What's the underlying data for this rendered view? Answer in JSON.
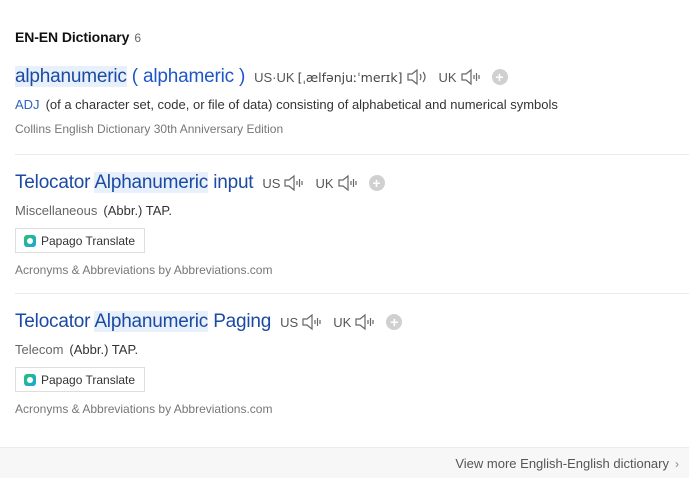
{
  "header": {
    "title": "EN-EN Dictionary",
    "count": "6"
  },
  "entries": [
    {
      "word_hl": "alphanumeric",
      "word_rest": " ( alphameric )",
      "pron_label": "US·UK",
      "ipa": "[ˌælfənjuːˈmerɪk]",
      "uk_label": "UK",
      "pos": "ADJ",
      "definition": "(of a character set, code, or file of data) consisting of alphabetical and numerical symbols",
      "source": "Collins English Dictionary 30th Anniversary Edition"
    },
    {
      "word_pre": "Telocator ",
      "word_hl": "Alphanumeric",
      "word_rest": " input",
      "us_label": "US",
      "uk_label": "UK",
      "category": "Miscellaneous",
      "definition": "(Abbr.) TAP.",
      "papago": "Papago Translate",
      "source": "Acronyms & Abbreviations by Abbreviations.com"
    },
    {
      "word_pre": "Telocator ",
      "word_hl": "Alphanumeric",
      "word_rest": " Paging",
      "us_label": "US",
      "uk_label": "UK",
      "category": "Telecom",
      "definition": "(Abbr.) TAP.",
      "papago": "Papago Translate",
      "source": "Acronyms & Abbreviations by Abbreviations.com"
    }
  ],
  "footer": {
    "more": "View more English-English dictionary",
    "chevron": "›"
  },
  "colors": {
    "link": "#1b4aa4",
    "highlight": "#e8f0fc",
    "pos": "#2f63c0"
  }
}
